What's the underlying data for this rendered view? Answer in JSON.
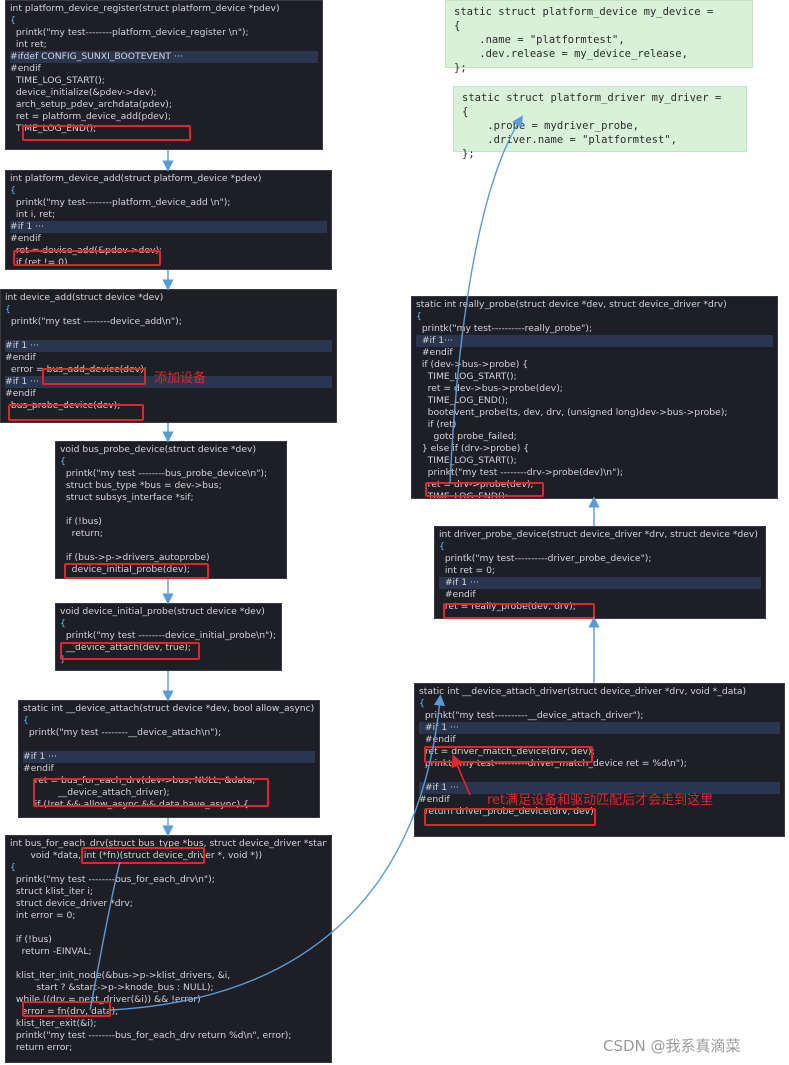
{
  "code_boxes": [
    {
      "id": "platform-device-register",
      "lines": [
        "int platform_device_register(struct platform_device *pdev)",
        "{",
        "  printk(\"my test--------platform_device_register \\n\");",
        "  int ret;",
        "#ifdef CONFIG_SUNXI_BOOTEVENT ···",
        "#endif",
        "  TIME_LOG_START();",
        "  device_initialize(&pdev->dev);",
        "  arch_setup_pdev_archdata(pdev);",
        "  ret = platform_device_add(pdev);",
        "  TIME_LOG_END();"
      ]
    },
    {
      "id": "platform-device-add",
      "lines": [
        "int platform_device_add(struct platform_device *pdev)",
        "{",
        "  printk(\"my test--------platform_device_add \\n\");",
        "  int i, ret;",
        "#if 1 ···",
        "#endif",
        "  ret = device_add(&pdev->dev);",
        "  if (ret != 0)"
      ]
    },
    {
      "id": "device-add",
      "lines": [
        "int device_add(struct device *dev)",
        "{",
        "  printk(\"my test --------device_add\\n\");",
        "",
        "#if 1 ···",
        "#endif",
        "  error = bus_add_device(dev);",
        "#if 1 ···",
        "#endif",
        "  bus_probe_device(dev);"
      ]
    },
    {
      "id": "bus-probe-device",
      "lines": [
        "void bus_probe_device(struct device *dev)",
        "{",
        "  printk(\"my test --------bus_probe_device\\n\");",
        "  struct bus_type *bus = dev->bus;",
        "  struct subsys_interface *sif;",
        "",
        "  if (!bus)",
        "    return;",
        "",
        "  if (bus->p->drivers_autoprobe)",
        "    device_initial_probe(dev);"
      ]
    },
    {
      "id": "device-initial-probe",
      "lines": [
        "void device_initial_probe(struct device *dev)",
        "{",
        "  printk(\"my test --------device_initial_probe\\n\");",
        "  __device_attach(dev, true);",
        "}"
      ]
    },
    {
      "id": "device-attach",
      "lines": [
        "static int __device_attach(struct device *dev, bool allow_async)",
        "{",
        "  printk(\"my test --------__device_attach\\n\");",
        "",
        "#if 1 ···",
        "#endif",
        "    ret = bus_for_each_drv(dev->bus, NULL, &data,",
        "            __device_attach_driver);",
        "    if (!ret && allow_async && data.have_async) {"
      ]
    },
    {
      "id": "bus-for-each-drv",
      "lines": [
        "int bus_for_each_drv(struct bus_type *bus, struct device_driver *start,",
        "       void *data, int (*fn)(struct device_driver *, void *))",
        "{",
        "  printk(\"my test --------bus_for_each_drv\\n\");",
        "  struct klist_iter i;",
        "  struct device_driver *drv;",
        "  int error = 0;",
        "",
        "  if (!bus)",
        "    return -EINVAL;",
        "",
        "  klist_iter_init_node(&bus->p->klist_drivers, &i,",
        "         start ? &start->p->knode_bus : NULL);",
        "  while ((drv = next_driver(&i)) && !error)",
        "    error = fn(drv, data);",
        "  klist_iter_exit(&i);",
        "  printk(\"my test --------bus_for_each_drv return %d\\n\", error);",
        "  return error;"
      ]
    },
    {
      "id": "really-probe",
      "lines": [
        "static int really_probe(struct device *dev, struct device_driver *drv)",
        "{",
        "  printk(\"my test----------really_probe\");",
        "  #if 1···",
        "  #endif",
        "  if (dev->bus->probe) {",
        "    TIME_LOG_START();",
        "    ret = dev->bus->probe(dev);",
        "    TIME_LOG_END();",
        "    bootevent_probe(ts, dev, drv, (unsigned long)dev->bus->probe);",
        "    if (ret)",
        "      goto probe_failed;",
        "  } else if (drv->probe) {",
        "    TIME_LOG_START();",
        "    prinkt(\"my test --------drv->probe(dev)\\n\");",
        "    ret = drv->probe(dev);",
        "    TIME_LOG_END();"
      ]
    },
    {
      "id": "driver-probe-device",
      "lines": [
        "int driver_probe_device(struct device_driver *drv, struct device *dev)",
        "{",
        "  printk(\"my test----------driver_probe_device\");",
        "  int ret = 0;",
        "  #if 1 ···",
        "  #endif",
        "  ret = really_probe(dev, drv);"
      ]
    },
    {
      "id": "device-attach-driver",
      "lines": [
        "static int __device_attach_driver(struct device_driver *drv, void *_data)",
        "{",
        "  prinkt(\"my test----------__device_attach_driver\");",
        "  #if 1 ···",
        "  #endif",
        "  ret = driver_match_device(drv, dev);",
        "  prinkt(\"my test----------driver_match_device ret = %d\\n\");",
        "",
        "  #if 1 ···",
        "#endif",
        "  return driver_probe_device(drv, dev);"
      ]
    }
  ],
  "green_boxes": [
    {
      "id": "my-device",
      "lines": [
        "static struct platform_device my_device =",
        "{",
        "    .name = \"platformtest\",",
        "    .dev.release = my_device_release,",
        "};"
      ]
    },
    {
      "id": "my-driver",
      "lines": [
        "static struct platform_driver my_driver =",
        "{",
        "    .probe = mydriver_probe,",
        "    .driver.name = \"platformtest\",",
        "};"
      ]
    }
  ],
  "annotations": {
    "add_device": "添加设备",
    "ret_note": "ret满足设备和驱动匹配后才会走到这里"
  },
  "watermark": "CSDN @我系真滴菜",
  "colors": {
    "arrow": "#5b9bd5",
    "highlight_border": "#e0262a",
    "code_bg": "#1e1f26",
    "green_bg": "#d8f1d8"
  }
}
